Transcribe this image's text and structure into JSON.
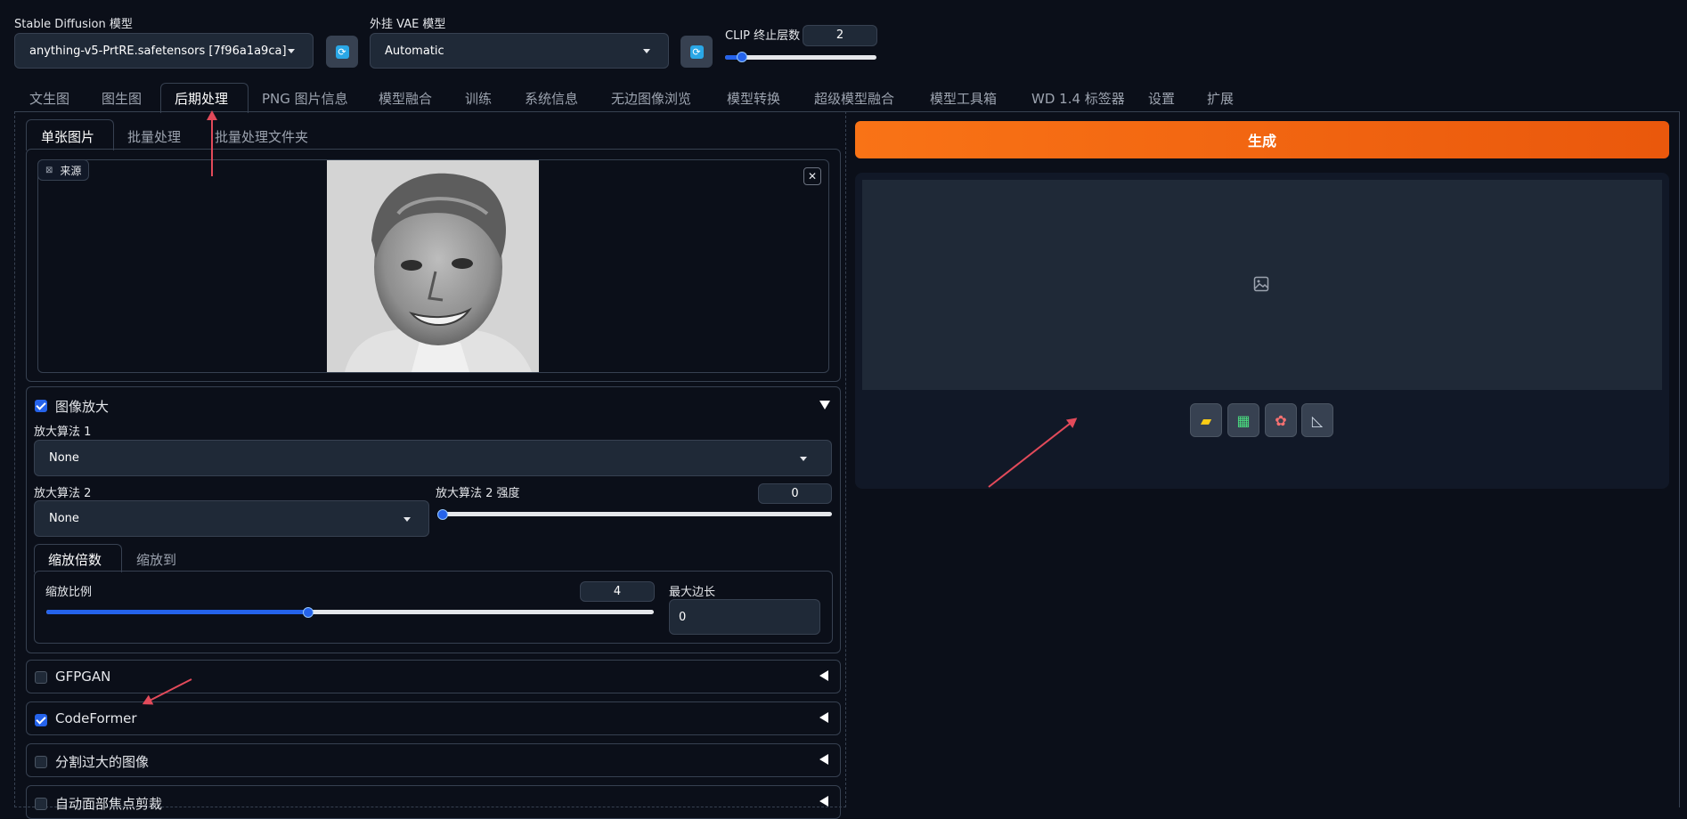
{
  "model": {
    "label": "Stable Diffusion 模型",
    "value": "anything-v5-PrtRE.safetensors [7f96a1a9ca]"
  },
  "vae": {
    "label": "外挂 VAE 模型",
    "value": "Automatic"
  },
  "clip": {
    "label": "CLIP 终止层数",
    "value": "2",
    "fraction": 0.08
  },
  "tabs": [
    "文生图",
    "图生图",
    "后期处理",
    "PNG 图片信息",
    "模型融合",
    "训练",
    "系统信息",
    "无边图像浏览",
    "模型转换",
    "超级模型融合",
    "模型工具箱",
    "WD 1.4 标签器",
    "设置",
    "扩展"
  ],
  "subtabs": [
    "单张图片",
    "批量处理",
    "批量处理文件夹"
  ],
  "source": {
    "label": "来源"
  },
  "upscale": {
    "title": "图像放大",
    "upscaler1": {
      "label": "放大算法 1",
      "value": "None"
    },
    "upscaler2": {
      "label": "放大算法 2",
      "value": "None"
    },
    "upscaler2_strength": {
      "label": "放大算法 2 强度",
      "value": "0",
      "fraction": 0.0
    },
    "mode_tabs": [
      "缩放倍数",
      "缩放到"
    ],
    "resize": {
      "label": "缩放比例",
      "value": "4",
      "fraction": 0.43
    },
    "max_side": {
      "label": "最大边长",
      "value": "0"
    }
  },
  "accordions": [
    {
      "title": "GFPGAN",
      "checked": false
    },
    {
      "title": "CodeFormer",
      "checked": true
    },
    {
      "title": "分割过大的图像",
      "checked": false
    },
    {
      "title": "自动面部焦点剪裁",
      "checked": false
    }
  ],
  "generate_label": "生成",
  "colors": {
    "accent": "#f97316",
    "checkbox": "#2563eb",
    "background": "#0b0f19"
  },
  "tools": [
    "folder-icon",
    "image-icon",
    "palette-icon",
    "ruler-icon"
  ]
}
